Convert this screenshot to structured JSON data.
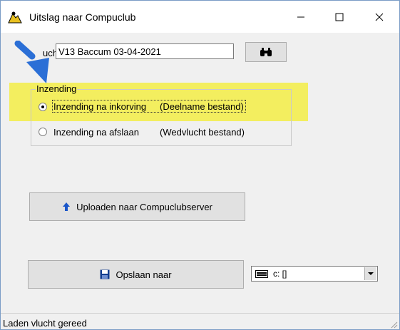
{
  "window": {
    "title": "Uitslag naar Compuclub"
  },
  "vlucht": {
    "label_visible": "ucht",
    "value": "V13 Baccum 03-04-2021"
  },
  "inzending": {
    "legend": "Inzending",
    "options": [
      {
        "label": "Inzending na inkorving",
        "detail": "(Deelname bestand)",
        "checked": true
      },
      {
        "label": "Inzending na afslaan",
        "detail": "(Wedvlucht bestand)",
        "checked": false
      }
    ]
  },
  "buttons": {
    "upload": "Uploaden naar Compuclubserver",
    "save": "Opslaan naar"
  },
  "drive": {
    "selected": "c: []"
  },
  "status": {
    "text": "Laden vlucht gereed"
  },
  "colors": {
    "highlight": "#f3ee5f",
    "arrow": "#2b6fd6",
    "upload_icon": "#1a56c9",
    "save_icon": "#123d8f"
  },
  "icons": [
    "app-icon",
    "minimize-icon",
    "maximize-icon",
    "close-icon",
    "binoculars-icon",
    "upload-arrow-icon",
    "floppy-disk-icon",
    "drive-icon",
    "chevron-down-icon",
    "resize-grip-icon"
  ]
}
